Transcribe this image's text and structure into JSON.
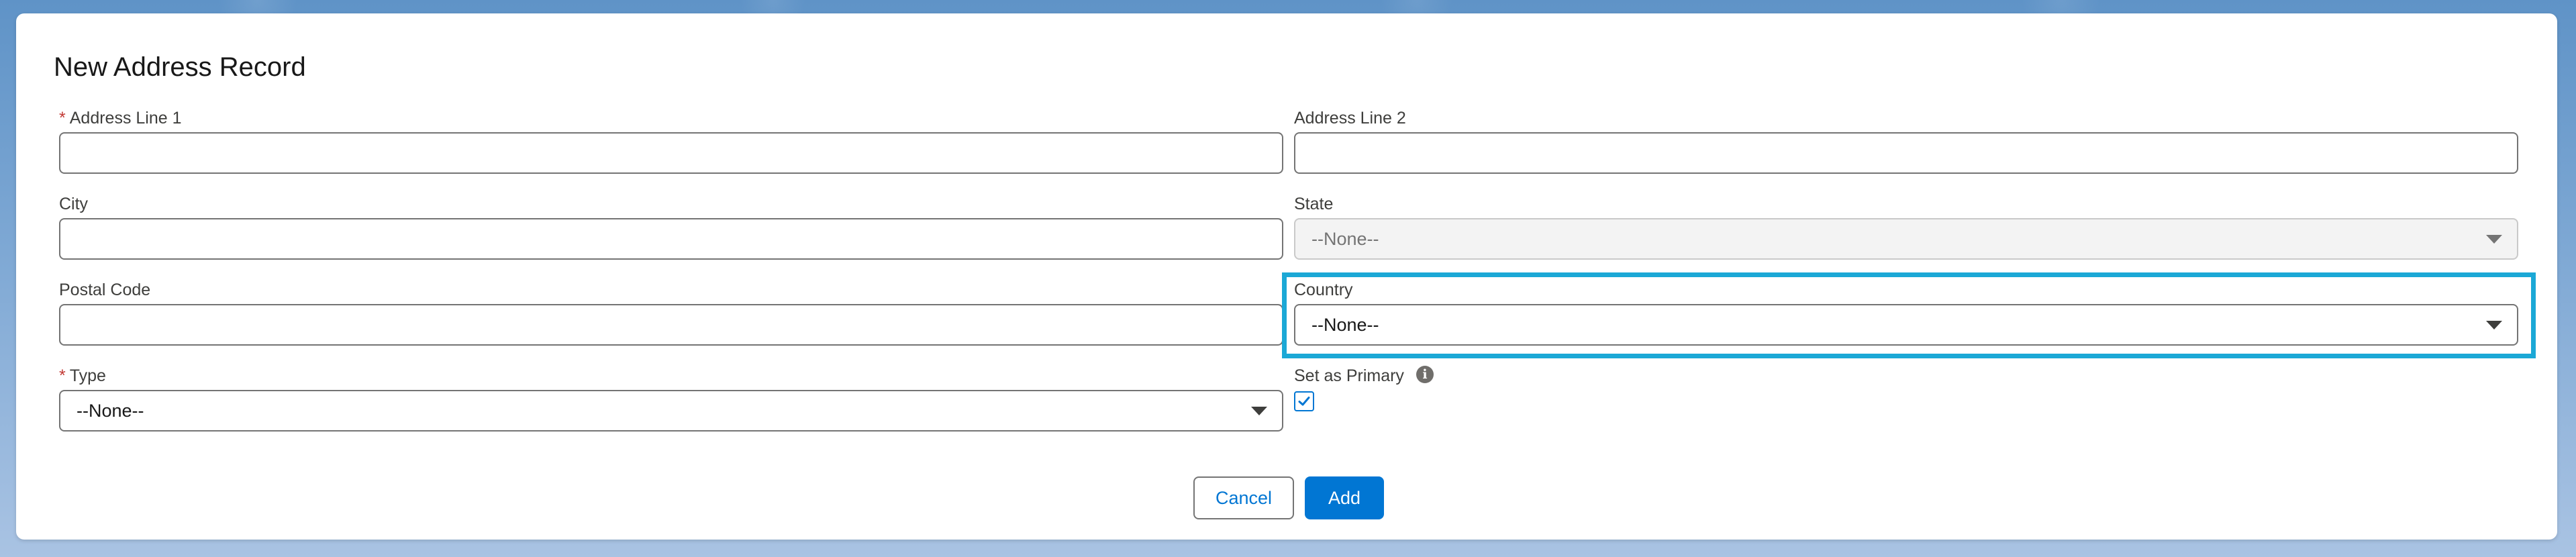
{
  "modal": {
    "title": "New Address Record"
  },
  "form": {
    "address_line_1": {
      "label": "Address Line 1",
      "required_marker": "*",
      "value": ""
    },
    "address_line_2": {
      "label": "Address Line 2",
      "value": ""
    },
    "city": {
      "label": "City",
      "value": ""
    },
    "state": {
      "label": "State",
      "selected": "--None--",
      "disabled": true
    },
    "postal_code": {
      "label": "Postal Code",
      "value": ""
    },
    "country": {
      "label": "Country",
      "selected": "--None--"
    },
    "type": {
      "label": "Type",
      "required_marker": "*",
      "selected": "--None--"
    },
    "set_as_primary": {
      "label": "Set as Primary",
      "checked": true,
      "info_icon": "info-icon"
    }
  },
  "buttons": {
    "cancel_label": "Cancel",
    "add_label": "Add"
  },
  "colors": {
    "brand": "#0176d3",
    "required": "#c23934",
    "highlight": "#1ba8d6"
  }
}
